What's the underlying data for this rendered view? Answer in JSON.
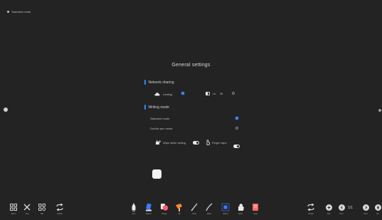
{
  "header": {
    "mode_label": "Standard mode"
  },
  "settings": {
    "title": "General settings",
    "network": {
      "heading": "Network sharing",
      "option_a_label": "Lanling",
      "option_a_selected": true,
      "option_b_sublabel": "Lb",
      "option_b_tag": "Bt",
      "option_b_selected": false
    },
    "writing": {
      "heading": "Writing mode",
      "standard_label": "Standard mode",
      "standard_selected": true,
      "double_label": "Double pen mode",
      "double_selected": false,
      "wipe_label": "Wipe while writing",
      "wipe_on": true,
      "finger_label": "Finger wipe",
      "finger_on": true
    }
  },
  "toolbar": {
    "left": [
      {
        "label": "Menu",
        "icon": "grid-icon"
      },
      {
        "label": "Tool",
        "icon": "tools-icon"
      },
      {
        "label": "Diff",
        "icon": "apps-icon"
      },
      {
        "label": "Switch",
        "icon": "switch-icon"
      }
    ],
    "center": [
      {
        "label": "Pen",
        "icon": "pen-icon",
        "color": "#e8e8e8"
      },
      {
        "label": "Eraser",
        "icon": "eraser-icon",
        "color": "#3b7bff"
      },
      {
        "label": "Shape",
        "icon": "shape-icon",
        "color": "#ff5a6a"
      },
      {
        "label": "Fill",
        "icon": "fill-icon",
        "color": "#ff8a2a"
      },
      {
        "label": "Undo",
        "icon": "undo-icon",
        "color": "#d8d8d8"
      },
      {
        "label": "Redo",
        "icon": "redo-icon",
        "color": "#d8d8d8"
      },
      {
        "label": "Select",
        "icon": "select-icon",
        "color": "#3b7bff"
      },
      {
        "label": "Hand",
        "icon": "hand-icon",
        "color": "#d8d8d8"
      },
      {
        "label": "Clear",
        "icon": "clear-icon",
        "color": "#ff6b6b"
      }
    ],
    "right": {
      "switch_label": "Switch",
      "add_label": "Add",
      "prev_label": "Prev",
      "page_indicator": "1/1",
      "next_label": "Next",
      "list_label": "List"
    }
  }
}
